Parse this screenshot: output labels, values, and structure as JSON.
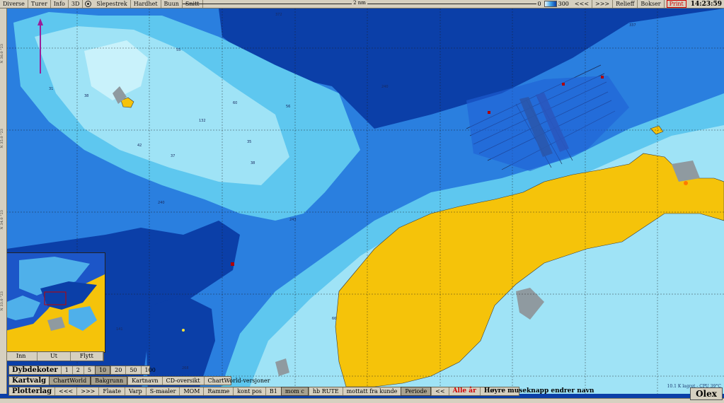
{
  "menu": [
    "Diverse",
    "Turer",
    "Info",
    "3D",
    "Slepestrek",
    "Hardhet",
    "Buun",
    "Snitt"
  ],
  "scale_label": "2 nm",
  "depth_range": {
    "min": "0",
    "max": "300"
  },
  "nav": {
    "back": "<<<",
    "fwd": ">>>"
  },
  "right_menu": {
    "relieff": "Relieff",
    "bokser": "Bokser",
    "print": "Print"
  },
  "clock": "14:23:59",
  "minimap_buttons": [
    "Inn",
    "Ut",
    "Flytt"
  ],
  "dybdekoter": {
    "label": "Dybdekoter",
    "values": [
      "1",
      "2",
      "5",
      "10",
      "20",
      "50",
      "100"
    ],
    "selected": "10"
  },
  "kartvalg": {
    "label": "Kartvalg",
    "items": [
      "ChartWorld",
      "Bakgrunn",
      "Kartnavn",
      "CD-oversikt",
      "ChartWorld-versjoner"
    ]
  },
  "plotterlag": {
    "label": "Plotterlag",
    "items": [
      "<<<",
      ">>>",
      "Flaate",
      "Varp",
      "S-maaler",
      "MOM",
      "Ramme",
      "kont pos",
      "B1",
      "mom c",
      "hb RUTE",
      "mottatt fra kunde",
      "Periode",
      "<<"
    ],
    "alle": "Alle år",
    "hoyre": "Høyre museknapp endrer navn"
  },
  "status": "10.1 K lagret - CPU 39°C",
  "brand": "Olex",
  "colors": {
    "land": "#f5c30a",
    "deep": "#0b3fa8",
    "mid": "#2a7fdf",
    "shallow": "#6fd3f0",
    "veryshallow": "#b6ecf8"
  }
}
